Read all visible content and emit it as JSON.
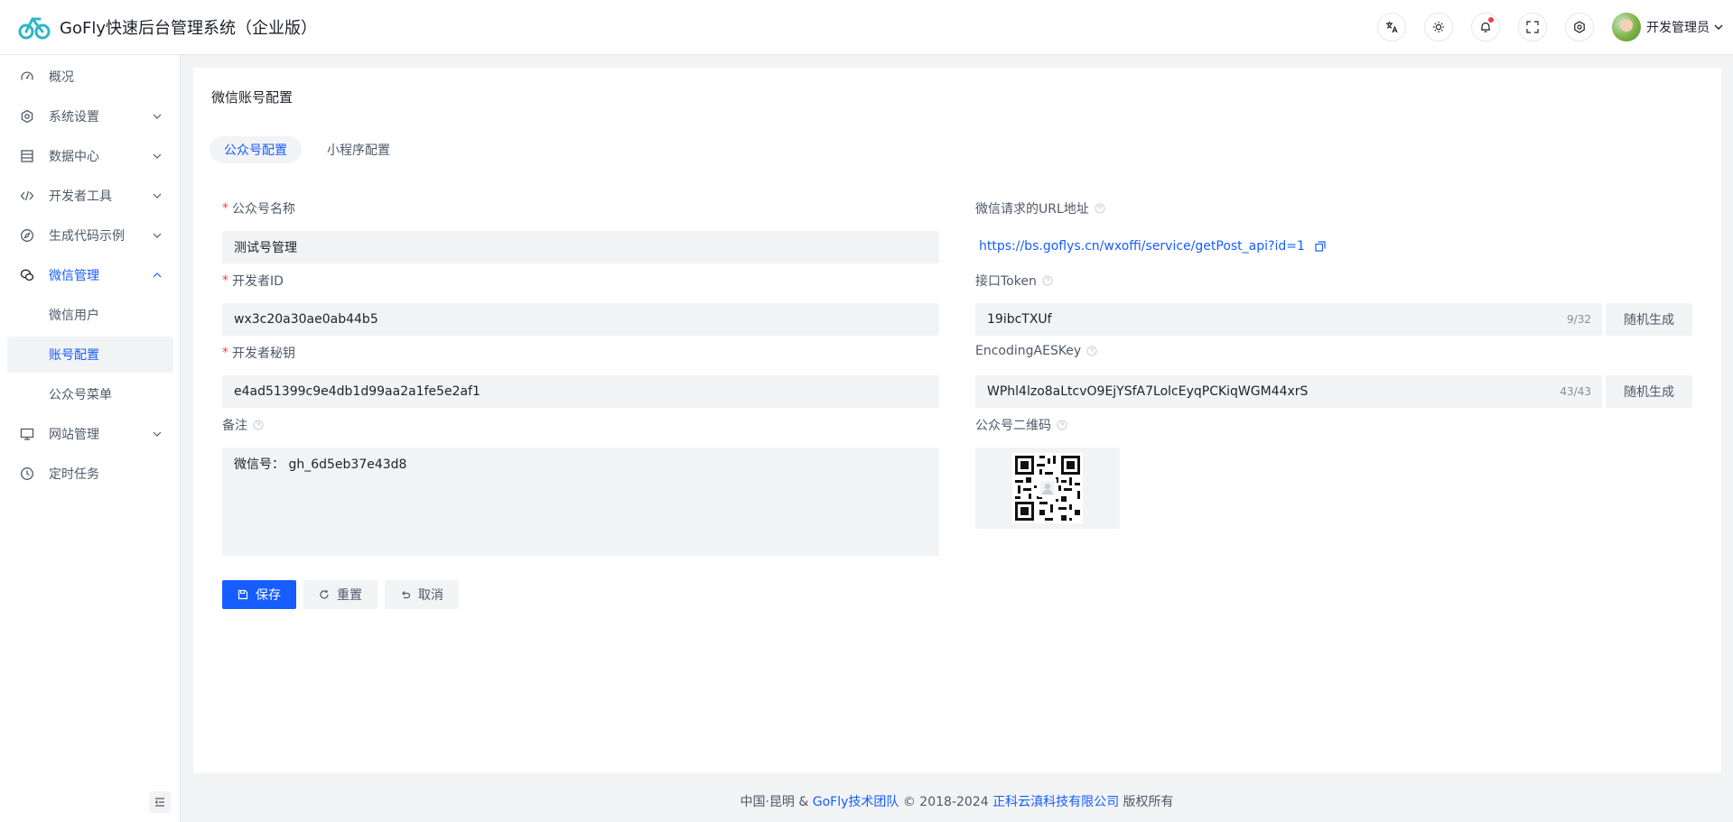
{
  "header": {
    "app_title": "GoFly快速后台管理系统（企业版）",
    "user_name": "开发管理员",
    "icons": [
      "translate-icon",
      "theme-sun-icon",
      "bell-icon",
      "fullscreen-icon",
      "settings-icon"
    ]
  },
  "sidebar": {
    "items": [
      {
        "label": "概况",
        "icon": "dashboard-icon"
      },
      {
        "label": "系统设置",
        "icon": "gear-icon"
      },
      {
        "label": "数据中心",
        "icon": "database-icon"
      },
      {
        "label": "开发者工具",
        "icon": "code-icon"
      },
      {
        "label": "生成代码示例",
        "icon": "compass-icon"
      },
      {
        "label": "微信管理",
        "icon": "wechat-icon"
      },
      {
        "label": "微信用户"
      },
      {
        "label": "账号配置"
      },
      {
        "label": "公众号菜单"
      },
      {
        "label": "网站管理",
        "icon": "desktop-icon"
      },
      {
        "label": "定时任务",
        "icon": "clock-icon"
      }
    ]
  },
  "main": {
    "title": "微信账号配置",
    "tabs": [
      {
        "label": "公众号配置",
        "active": true
      },
      {
        "label": "小程序配置",
        "active": false
      }
    ],
    "form": {
      "name_label": "公众号名称",
      "name_value": "测试号管理",
      "appid_label": "开发者ID",
      "appid_value": "wx3c20a30ae0ab44b5",
      "secret_label": "开发者秘钥",
      "secret_value": "e4ad51399c9e4db1d99aa2a1fe5e2af1",
      "remark_label": "备注",
      "remark_value": "微信号： gh_6d5eb37e43d8",
      "url_label": "微信请求的URL地址",
      "url_value": "https://bs.goflys.cn/wxoffi/service/getPost_api?id=1",
      "token_label": "接口Token",
      "token_value": "19ibcTXUf",
      "token_counter": "9/32",
      "aes_label": "EncodingAESKey",
      "aes_value": "WPhl4lzo8aLtcvO9EjYSfA7LolcEyqPCKiqWGM44xrS",
      "aes_counter": "43/43",
      "random_label": "随机生成",
      "qr_label": "公众号二维码"
    },
    "buttons": {
      "save": "保存",
      "reset": "重置",
      "cancel": "取消"
    }
  },
  "footer": {
    "prefix": "中国·昆明 &",
    "team": "GoFly技术团队",
    "copyright": "© 2018-2024",
    "company": "正科云滇科技有限公司",
    "suffix": "版权所有"
  },
  "colors": {
    "accent": "#165dff",
    "required": "#f53f3f",
    "input_bg": "#f2f3f5"
  }
}
